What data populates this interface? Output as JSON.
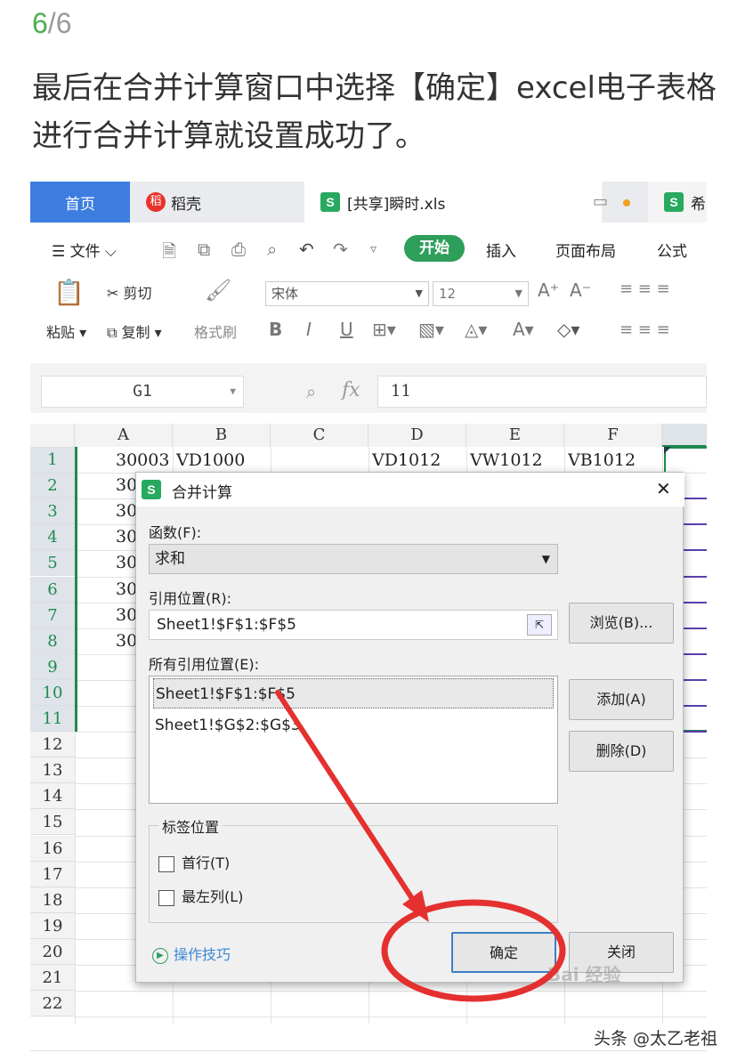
{
  "header": {
    "step_current": "6",
    "step_total": "/6",
    "caption": "最后在合并计算窗口中选择【确定】excel电子表格进行合并计算就设置成功了。"
  },
  "app": {
    "tabs": {
      "home": "首页",
      "daoke": "稻壳",
      "file": "[共享]瞬时.xls",
      "next": "希",
      "s_icon": "S",
      "dk_icon": "稻"
    },
    "menu": {
      "file": "文件",
      "start": "开始",
      "insert": "插入",
      "layout": "页面布局",
      "formula": "公式"
    },
    "ribbon": {
      "cut": "剪切",
      "paste": "粘贴",
      "copy": "复制",
      "format_painter": "格式刷",
      "font": "宋体",
      "size": "12"
    },
    "formula_bar": {
      "cell_ref": "G1",
      "fx": "fx",
      "value": "11"
    },
    "columns": [
      "A",
      "B",
      "C",
      "D",
      "E",
      "F"
    ],
    "rows": [
      "1",
      "2",
      "3",
      "4",
      "5",
      "6",
      "7",
      "8",
      "9",
      "10",
      "11",
      "12",
      "13",
      "14",
      "15",
      "16",
      "17",
      "18",
      "19",
      "20",
      "21",
      "22"
    ],
    "row1": {
      "a": "30003",
      "b": "VD1000",
      "d": "VD1012",
      "e": "VW1012",
      "f": "VB1012"
    },
    "col_a_partial": "30"
  },
  "dialog": {
    "title": "合并计算",
    "func_label": "函数(F):",
    "func_value": "求和",
    "ref_label": "引用位置(R):",
    "ref_value": "Sheet1!$F$1:$F$5",
    "browse": "浏览(B)...",
    "all_refs_label": "所有引用位置(E):",
    "all_refs": [
      "Sheet1!$F$1:$F$5",
      "Sheet1!$G$2:$G$3"
    ],
    "add": "添加(A)",
    "delete": "删除(D)",
    "label_group": "标签位置",
    "top_row": "首行(T)",
    "left_col": "最左列(L)",
    "tips": "操作技巧",
    "ok": "确定",
    "close": "关闭",
    "close_x": "✕"
  },
  "watermark": "Bai 经验",
  "footer": "头条 @太乙老祖",
  "colors": {
    "green": "#4caf50",
    "tab_blue": "#3d7de0",
    "wps_green": "#2e9e5b",
    "annotation_red": "#e53030"
  }
}
